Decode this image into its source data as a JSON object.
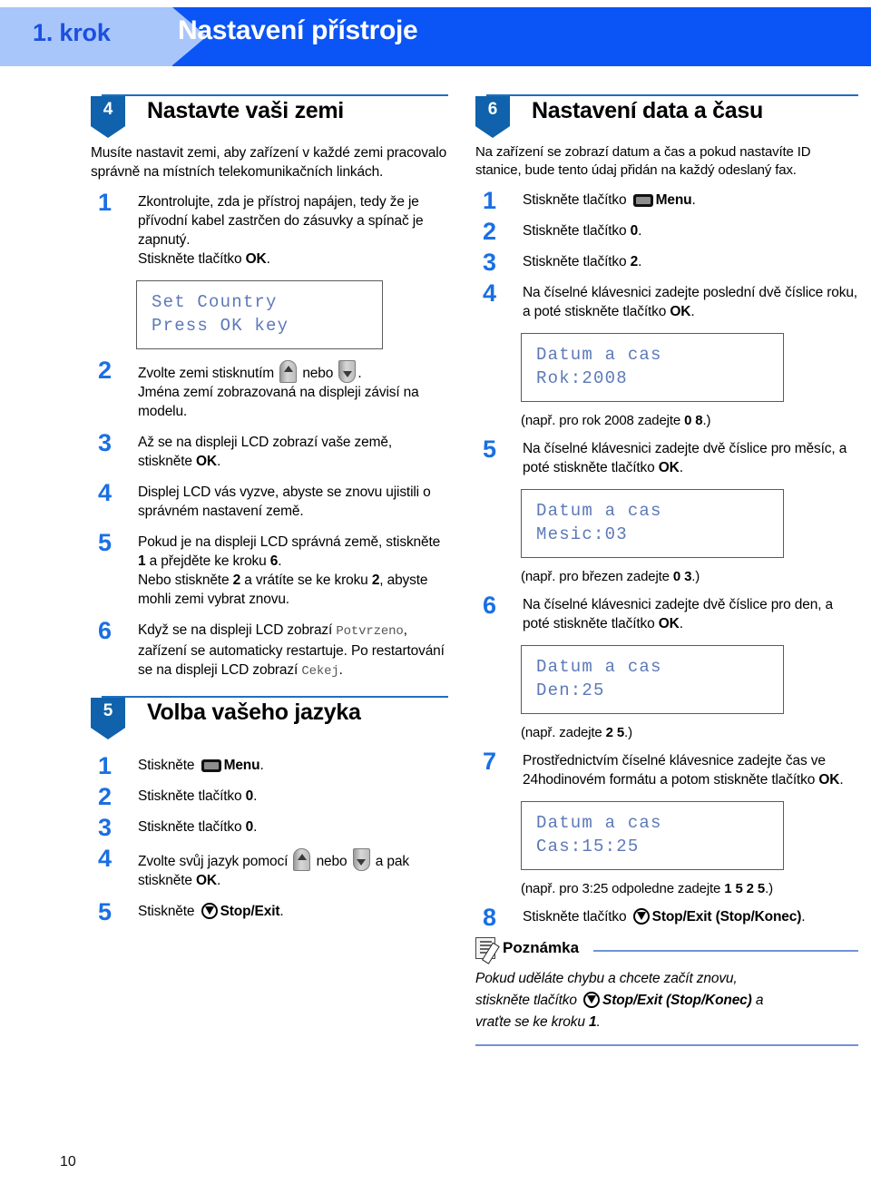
{
  "header": {
    "step_label": "1. krok",
    "title": "Nastavení přístroje",
    "left_bg": "#a9c6fb",
    "banner_bg": "#0b54f5"
  },
  "page_number": "10",
  "left_column": {
    "section4": {
      "number": "4",
      "title": "Nastavte vaši zemi",
      "intro": "Musíte nastavit zemi, aby zařízení v každé zemi pracovalo správně na místních telekomunikačních linkách.",
      "steps": [
        {
          "num": "1",
          "text_a": "Zkontrolujte, zda je přístroj napájen, tedy že je přívodní kabel zastrčen do zásuvky a spínač je zapnutý.",
          "text_b": "Stiskněte tlačítko ",
          "bold_b": "OK",
          "after_b": "."
        },
        {
          "num": "2",
          "text_a": "Zvolte zemi stisknutím ",
          "mid": " nebo ",
          "after": ".",
          "text_b": "Jména zemí zobrazovaná na displeji závisí na modelu."
        },
        {
          "num": "3",
          "text_a": "Až se na displeji LCD zobrazí vaše země, stiskněte ",
          "bold": "OK",
          "after": "."
        },
        {
          "num": "4",
          "text_a": "Displej LCD vás vyzve, abyste se znovu ujistili o správném nastavení země."
        },
        {
          "num": "5",
          "line1_a": "Pokud je na displeji LCD správná země, stiskněte ",
          "line1_b": "1",
          "line1_c": " a přejděte ke kroku ",
          "line1_d": "6",
          "line1_e": ".",
          "line2_a": "Nebo stiskněte ",
          "line2_b": "2",
          "line2_c": " a vrátíte se ke kroku ",
          "line2_d": "2",
          "line2_e": ", abyste mohli zemi vybrat znovu."
        },
        {
          "num": "6",
          "text_a": "Když se na displeji LCD zobrazí ",
          "mono1": "Potvrzeno",
          "text_b": ", zařízení se automaticky restartuje. Po restartování se na displeji LCD zobrazí ",
          "mono2": "Cekej",
          "text_c": "."
        }
      ],
      "lcd": {
        "line1": "Set Country",
        "line2": "Press OK key"
      }
    },
    "section5": {
      "number": "5",
      "title": "Volba vašeho jazyka",
      "steps": [
        {
          "num": "1",
          "pre": "Stiskněte ",
          "icon": "menu-icon",
          "bold": "Menu",
          "post": "."
        },
        {
          "num": "2",
          "pre": "Stiskněte tlačítko ",
          "bold": "0",
          "post": "."
        },
        {
          "num": "3",
          "pre": "Stiskněte tlačítko ",
          "bold": "0",
          "post": "."
        },
        {
          "num": "4",
          "pre": "Zvolte svůj jazyk pomocí ",
          "mid": " nebo ",
          "post": " a pak stiskněte ",
          "bold": "OK",
          "end": "."
        },
        {
          "num": "5",
          "pre": "Stiskněte ",
          "bold": "Stop/Exit",
          "post": "."
        }
      ]
    }
  },
  "right_column": {
    "section6": {
      "number": "6",
      "title": "Nastavení data a času",
      "intro": "Na zařízení se zobrazí datum a čas a pokud nastavíte ID stanice, bude tento údaj přidán na každý odeslaný fax.",
      "steps": [
        {
          "num": "1",
          "pre": "Stiskněte tlačítko ",
          "bold": "Menu",
          "post": "."
        },
        {
          "num": "2",
          "pre": "Stiskněte tlačítko ",
          "bold": "0",
          "post": "."
        },
        {
          "num": "3",
          "pre": "Stiskněte tlačítko ",
          "bold": "2",
          "post": "."
        },
        {
          "num": "4",
          "pre": "Na číselné klávesnici zadejte poslední dvě číslice roku, a poté stiskněte tlačítko ",
          "bold": "OK",
          "post": "."
        },
        {
          "num": "5",
          "pre": "Na číselné klávesnici zadejte dvě číslice pro měsíc, a poté stiskněte tlačítko ",
          "bold": "OK",
          "post": "."
        },
        {
          "num": "6",
          "pre": "Na číselné klávesnici zadejte dvě číslice pro den, a poté stiskněte tlačítko ",
          "bold": "OK",
          "post": "."
        },
        {
          "num": "7",
          "pre": "Prostřednictvím číselné klávesnice zadejte čas ve 24hodinovém formátu a potom stiskněte tlačítko ",
          "bold": "OK",
          "post": "."
        },
        {
          "num": "8",
          "pre": "Stiskněte tlačítko ",
          "bold": "Stop/Exit (Stop/Konec)",
          "post": "."
        }
      ],
      "lcd_year": {
        "line1": "Datum a cas",
        "line2": "Rok:2008"
      },
      "lcd_month": {
        "line1": "Datum a cas",
        "line2": "Mesic:03"
      },
      "lcd_day": {
        "line1": "Datum a cas",
        "line2": "Den:25"
      },
      "lcd_time": {
        "line1": "Datum a cas",
        "line2": "Cas:15:25"
      },
      "example_year": {
        "pre": "(např. pro rok 2008 zadejte ",
        "bold": "0 8",
        "post": ".)"
      },
      "example_month": {
        "pre": "(např. pro březen zadejte ",
        "bold": "0 3",
        "post": ".)"
      },
      "example_day": {
        "pre": "(např. zadejte ",
        "bold": "2 5",
        "post": ".)"
      },
      "example_time": {
        "pre": "(např. pro 3:25 odpoledne zadejte ",
        "bold": "1 5 2 5",
        "post": ".)"
      }
    },
    "note": {
      "title": "Poznámka",
      "line1": "Pokud uděláte chybu a chcete začít znovu,",
      "line2_pre": "stiskněte tlačítko ",
      "line2_bold": "Stop/Exit (Stop/Konec)",
      "line2_post": " a",
      "line3_pre": "vraťte se ke kroku ",
      "line3_bold": "1",
      "line3_post": "."
    }
  }
}
